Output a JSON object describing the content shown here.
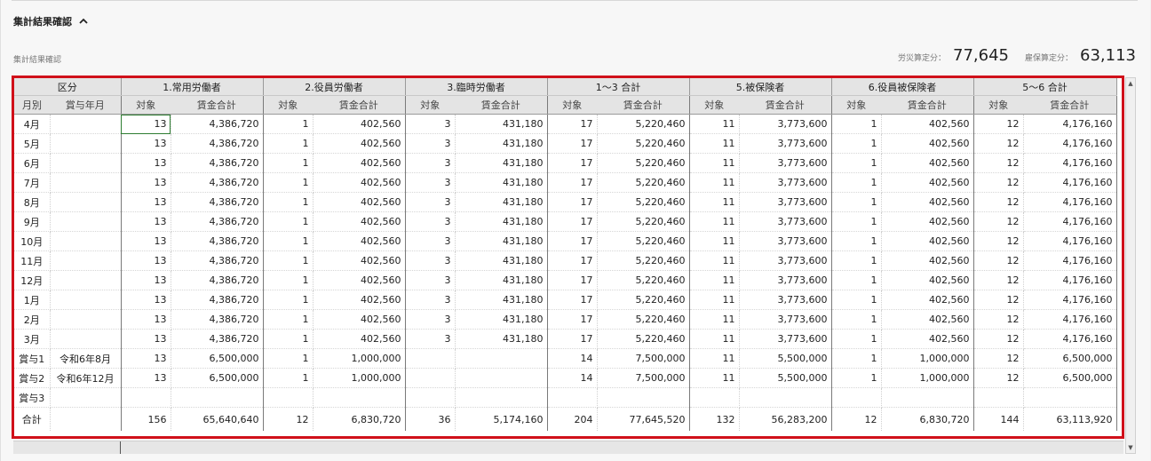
{
  "section": {
    "title": "集計結果確認"
  },
  "sub_label": "集計結果確認",
  "totals": {
    "rousai_label": "労災算定分：",
    "rousai_value": "77,645",
    "koyou_label": "雇保算定分：",
    "koyou_value": "63,113"
  },
  "table": {
    "group_headers": [
      "区分",
      "1.常用労働者",
      "2.役員労働者",
      "3.臨時労働者",
      "1〜3 合計",
      "5.被保険者",
      "6.役員被保険者",
      "5〜6 合計"
    ],
    "sub_headers": [
      "月別",
      "賞与年月",
      "対象",
      "賃金合計",
      "対象",
      "賃金合計",
      "対象",
      "賃金合計",
      "対象",
      "賃金合計",
      "対象",
      "賃金合計",
      "対象",
      "賃金合計",
      "対象",
      "賃金合計"
    ],
    "rows": [
      [
        "4月",
        "",
        "13",
        "4,386,720",
        "1",
        "402,560",
        "3",
        "431,180",
        "17",
        "5,220,460",
        "11",
        "3,773,600",
        "1",
        "402,560",
        "12",
        "4,176,160"
      ],
      [
        "5月",
        "",
        "13",
        "4,386,720",
        "1",
        "402,560",
        "3",
        "431,180",
        "17",
        "5,220,460",
        "11",
        "3,773,600",
        "1",
        "402,560",
        "12",
        "4,176,160"
      ],
      [
        "6月",
        "",
        "13",
        "4,386,720",
        "1",
        "402,560",
        "3",
        "431,180",
        "17",
        "5,220,460",
        "11",
        "3,773,600",
        "1",
        "402,560",
        "12",
        "4,176,160"
      ],
      [
        "7月",
        "",
        "13",
        "4,386,720",
        "1",
        "402,560",
        "3",
        "431,180",
        "17",
        "5,220,460",
        "11",
        "3,773,600",
        "1",
        "402,560",
        "12",
        "4,176,160"
      ],
      [
        "8月",
        "",
        "13",
        "4,386,720",
        "1",
        "402,560",
        "3",
        "431,180",
        "17",
        "5,220,460",
        "11",
        "3,773,600",
        "1",
        "402,560",
        "12",
        "4,176,160"
      ],
      [
        "9月",
        "",
        "13",
        "4,386,720",
        "1",
        "402,560",
        "3",
        "431,180",
        "17",
        "5,220,460",
        "11",
        "3,773,600",
        "1",
        "402,560",
        "12",
        "4,176,160"
      ],
      [
        "10月",
        "",
        "13",
        "4,386,720",
        "1",
        "402,560",
        "3",
        "431,180",
        "17",
        "5,220,460",
        "11",
        "3,773,600",
        "1",
        "402,560",
        "12",
        "4,176,160"
      ],
      [
        "11月",
        "",
        "13",
        "4,386,720",
        "1",
        "402,560",
        "3",
        "431,180",
        "17",
        "5,220,460",
        "11",
        "3,773,600",
        "1",
        "402,560",
        "12",
        "4,176,160"
      ],
      [
        "12月",
        "",
        "13",
        "4,386,720",
        "1",
        "402,560",
        "3",
        "431,180",
        "17",
        "5,220,460",
        "11",
        "3,773,600",
        "1",
        "402,560",
        "12",
        "4,176,160"
      ],
      [
        "1月",
        "",
        "13",
        "4,386,720",
        "1",
        "402,560",
        "3",
        "431,180",
        "17",
        "5,220,460",
        "11",
        "3,773,600",
        "1",
        "402,560",
        "12",
        "4,176,160"
      ],
      [
        "2月",
        "",
        "13",
        "4,386,720",
        "1",
        "402,560",
        "3",
        "431,180",
        "17",
        "5,220,460",
        "11",
        "3,773,600",
        "1",
        "402,560",
        "12",
        "4,176,160"
      ],
      [
        "3月",
        "",
        "13",
        "4,386,720",
        "1",
        "402,560",
        "3",
        "431,180",
        "17",
        "5,220,460",
        "11",
        "3,773,600",
        "1",
        "402,560",
        "12",
        "4,176,160"
      ],
      [
        "賞与1",
        "令和6年8月",
        "13",
        "6,500,000",
        "1",
        "1,000,000",
        "",
        "",
        "14",
        "7,500,000",
        "11",
        "5,500,000",
        "1",
        "1,000,000",
        "12",
        "6,500,000"
      ],
      [
        "賞与2",
        "令和6年12月",
        "13",
        "6,500,000",
        "1",
        "1,000,000",
        "",
        "",
        "14",
        "7,500,000",
        "11",
        "5,500,000",
        "1",
        "1,000,000",
        "12",
        "6,500,000"
      ],
      [
        "賞与3",
        "",
        "",
        "",
        "",
        "",
        "",
        "",
        "",
        "",
        "",
        "",
        "",
        "",
        "",
        ""
      ],
      [
        "合計",
        "",
        "156",
        "65,640,640",
        "12",
        "6,830,720",
        "36",
        "5,174,160",
        "204",
        "77,645,520",
        "132",
        "56,283,200",
        "12",
        "6,830,720",
        "144",
        "63,113,920"
      ]
    ]
  },
  "colors": {
    "highlight_border": "#d0101a",
    "selected_cell": "#2e7d32",
    "header_bg": "#e4e4e4"
  }
}
